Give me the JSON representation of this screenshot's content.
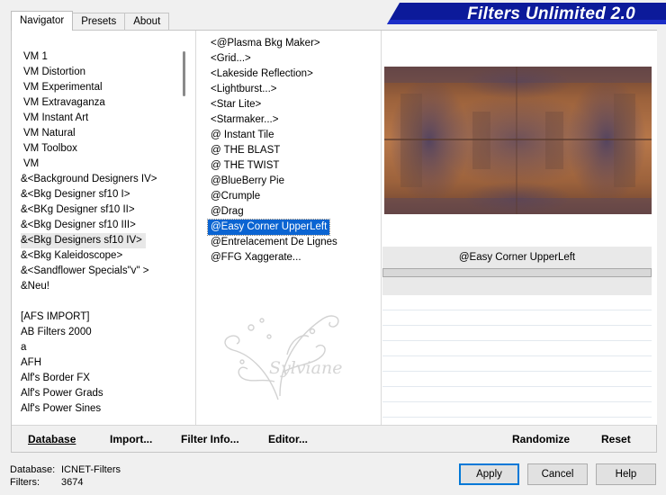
{
  "window": {
    "title": "Filters Unlimited 2.0",
    "tabs": [
      "Navigator",
      "Presets",
      "About"
    ]
  },
  "categories": [
    "VM 1",
    "VM Distortion",
    "VM Experimental",
    "VM Extravaganza",
    "VM Instant Art",
    "VM Natural",
    "VM Toolbox",
    "VM",
    "&<Background Designers IV>",
    "&<Bkg Designer sf10 I>",
    "&<BKg Designer sf10 II>",
    "&<Bkg Designer sf10 III>",
    "&<Bkg Designers sf10 IV>",
    "&<Bkg Kaleidoscope>",
    "&<Sandflower Specials\"v\" >",
    "&Neu!",
    "",
    "[AFS IMPORT]",
    "AB Filters 2000",
    "a",
    "AFH",
    "Alf's Border FX",
    "Alf's Power Grads",
    "Alf's Power Sines"
  ],
  "selected_category_index": 12,
  "filters": [
    "<@Plasma Bkg Maker>",
    "<Grid...>",
    "<Lakeside Reflection>",
    "<Lightburst...>",
    "<Star Lite>",
    "<Starmaker...>",
    "@ Instant Tile",
    "@ THE BLAST",
    "@ THE TWIST",
    "@BlueBerry Pie",
    "@Crumple",
    "@Drag",
    "@Easy Corner UpperLeft",
    "@Entrelacement De Lignes",
    "@FFG Xaggerate..."
  ],
  "selected_filter_index": 12,
  "watermark": "Sylviane",
  "preview": {
    "filter_name": "@Easy Corner UpperLeft",
    "progress": 0,
    "colors": {
      "brown": "#a2663d",
      "purple": "#5a4a66",
      "dark": "#3e2c28"
    }
  },
  "footer_buttons": {
    "database": "Database",
    "import": "Import...",
    "filter_info": "Filter Info...",
    "editor": "Editor...",
    "randomize": "Randomize",
    "reset": "Reset"
  },
  "info": {
    "database_label": "Database:",
    "database_value": "ICNET-Filters",
    "filters_label": "Filters:",
    "filters_value": "3674"
  },
  "dialog_buttons": {
    "apply": "Apply",
    "cancel": "Cancel",
    "help": "Help"
  },
  "accent_color": "#0a64d2"
}
